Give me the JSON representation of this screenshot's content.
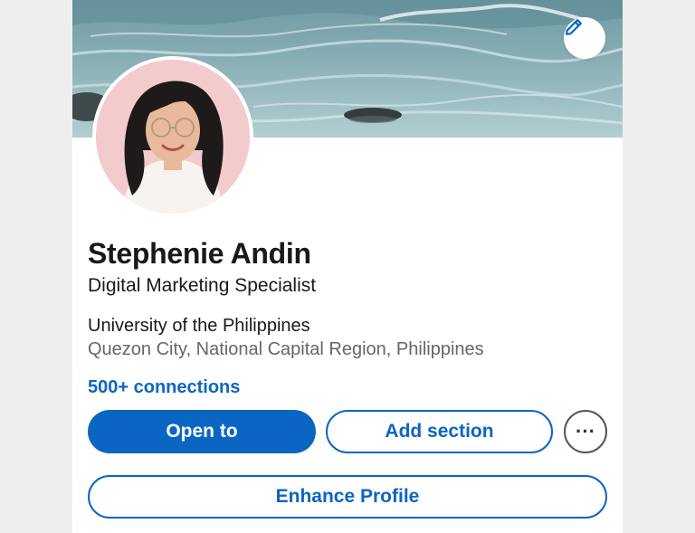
{
  "profile": {
    "name": "Stephenie Andin",
    "headline": "Digital Marketing Specialist",
    "school": "University of the Philippines",
    "location": "Quezon City, National Capital Region, Philippines",
    "connections": "500+ connections"
  },
  "actions": {
    "open_to_label": "Open to",
    "add_section_label": "Add section",
    "more_label": "···",
    "enhance_label": "Enhance Profile"
  },
  "icons": {
    "edit_banner": "pencil-icon",
    "more": "ellipsis-icon"
  },
  "colors": {
    "brand_blue": "#0a66c2",
    "text_primary": "#191919",
    "text_secondary": "#666666"
  }
}
